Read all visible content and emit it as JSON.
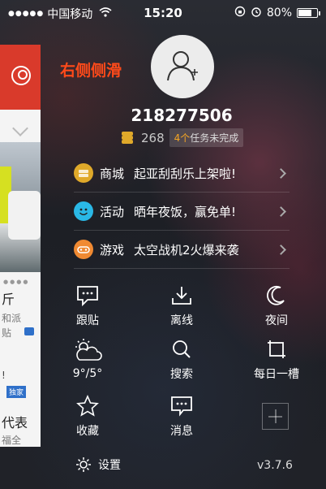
{
  "status_bar": {
    "signal_dots": "●●●●●",
    "carrier": "中国移动",
    "time": "15:20",
    "battery": "80%",
    "battery_level": 0.8
  },
  "drawer": {
    "title": "右侧侧滑",
    "user_id": "218277506",
    "coins": "268",
    "tasks_count": "4个",
    "tasks_text": "任务未完成",
    "promos": [
      {
        "category": "商城",
        "text": "起亚刮刮乐上架啦!",
        "icon": "shop-icon",
        "color": "#e0a92a"
      },
      {
        "category": "活动",
        "text": "晒年夜饭，赢免单!",
        "icon": "smile-icon",
        "color": "#2ab8e6"
      },
      {
        "category": "游戏",
        "text": "太空战机2火爆来袭",
        "icon": "game-icon",
        "color": "#f08a32"
      }
    ],
    "grid": [
      {
        "label": "跟贴",
        "icon": "comment-icon"
      },
      {
        "label": "离线",
        "icon": "download-icon"
      },
      {
        "label": "夜间",
        "icon": "moon-icon"
      },
      {
        "label": "9°/5°",
        "icon": "weather-icon"
      },
      {
        "label": "搜索",
        "icon": "search-icon"
      },
      {
        "label": "每日一槽",
        "icon": "crop-icon"
      },
      {
        "label": "收藏",
        "icon": "star-icon"
      },
      {
        "label": "消息",
        "icon": "message-icon"
      }
    ],
    "settings_label": "设置",
    "version": "v3.7.6"
  },
  "peek_panel": {
    "line1": "斤",
    "line2": "和派",
    "line3": "贴",
    "line4": "!",
    "tag": "独家",
    "line5": "代表",
    "line6": "福全"
  }
}
